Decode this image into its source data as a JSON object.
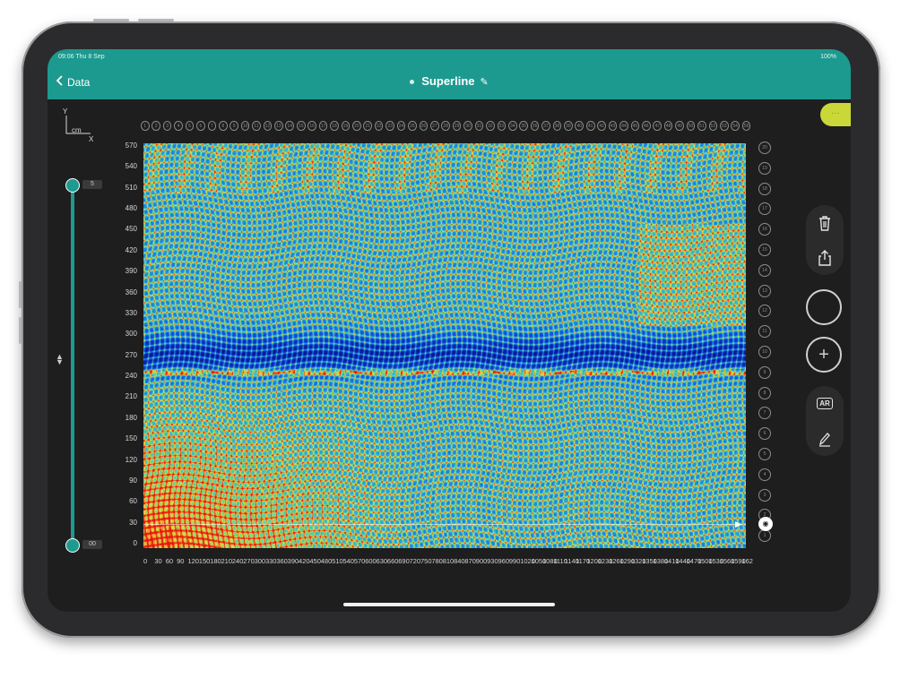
{
  "status_bar": {
    "left": "09:06 Thu 8 Sep",
    "right": "100%"
  },
  "nav": {
    "back_label": "Data",
    "title": "Superline"
  },
  "corner_pill": "···",
  "axis": {
    "y": "Y",
    "unit": "cm",
    "x": "X"
  },
  "depth_slider": {
    "top_value": "5",
    "bottom_value": "00"
  },
  "y_ticks": [
    "570",
    "540",
    "510",
    "480",
    "450",
    "420",
    "390",
    "360",
    "330",
    "300",
    "270",
    "240",
    "210",
    "180",
    "150",
    "120",
    "90",
    "60",
    "30",
    "0"
  ],
  "x_ticks": [
    "0",
    "30",
    "60",
    "90",
    "120",
    "150",
    "180",
    "210",
    "240",
    "270",
    "300",
    "330",
    "360",
    "390",
    "420",
    "450",
    "480",
    "510",
    "540",
    "570",
    "600",
    "630",
    "660",
    "690",
    "720",
    "750",
    "780",
    "810",
    "840",
    "870",
    "900",
    "930",
    "960",
    "990",
    "1020",
    "1050",
    "1080",
    "1110",
    "1140",
    "1170",
    "1200",
    "1230",
    "1260",
    "1290",
    "1320",
    "1350",
    "1380",
    "1410",
    "1440",
    "1470",
    "1500",
    "1530",
    "1560",
    "1590",
    "1620"
  ],
  "top_markers": [
    "1",
    "2",
    "3",
    "4",
    "5",
    "6",
    "7",
    "8",
    "9",
    "10",
    "11",
    "12",
    "13",
    "14",
    "15",
    "16",
    "17",
    "18",
    "19",
    "20",
    "21",
    "22",
    "23",
    "24",
    "25",
    "26",
    "27",
    "28",
    "29",
    "30",
    "31",
    "32",
    "33",
    "34",
    "35",
    "36",
    "37",
    "38",
    "39",
    "40",
    "41",
    "42",
    "43",
    "44",
    "45",
    "46",
    "47",
    "48",
    "49",
    "50",
    "51",
    "52",
    "53",
    "54",
    "55"
  ],
  "right_markers": [
    "20",
    "19",
    "18",
    "17",
    "16",
    "15",
    "14",
    "13",
    "12",
    "11",
    "10",
    "9",
    "8",
    "7",
    "6",
    "5",
    "4",
    "3",
    "2",
    "1"
  ],
  "colors": {
    "accent": "#1c9a8f",
    "pill": "#c9d838"
  },
  "icons": {
    "trash": "trash-icon",
    "share": "share-icon",
    "record": "record-button",
    "add": "plus-icon",
    "ar": "ar-icon",
    "edit": "pen-icon"
  }
}
